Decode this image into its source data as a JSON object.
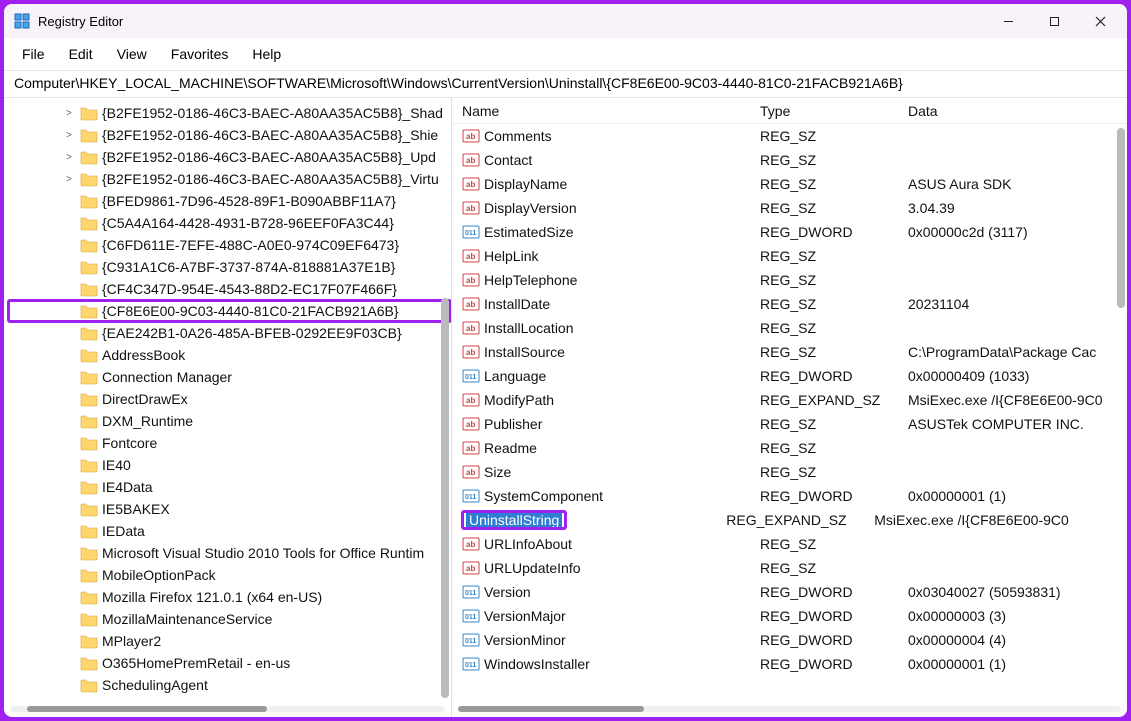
{
  "app": {
    "title": "Registry Editor"
  },
  "menubar": [
    "File",
    "Edit",
    "View",
    "Favorites",
    "Help"
  ],
  "address": "Computer\\HKEY_LOCAL_MACHINE\\SOFTWARE\\Microsoft\\Windows\\CurrentVersion\\Uninstall\\{CF8E6E00-9C03-4440-81C0-21FACB921A6B}",
  "tree": [
    {
      "label": "{B2FE1952-0186-46C3-BAEC-A80AA35AC5B8}_Shad",
      "caret": ">"
    },
    {
      "label": "{B2FE1952-0186-46C3-BAEC-A80AA35AC5B8}_Shie",
      "caret": ">"
    },
    {
      "label": "{B2FE1952-0186-46C3-BAEC-A80AA35AC5B8}_Upd",
      "caret": ">"
    },
    {
      "label": "{B2FE1952-0186-46C3-BAEC-A80AA35AC5B8}_Virtu",
      "caret": ">"
    },
    {
      "label": "{BFED9861-7D96-4528-89F1-B090ABBF11A7}",
      "caret": ""
    },
    {
      "label": "{C5A4A164-4428-4931-B728-96EEF0FA3C44}",
      "caret": ""
    },
    {
      "label": "{C6FD611E-7EFE-488C-A0E0-974C09EF6473}",
      "caret": ""
    },
    {
      "label": "{C931A1C6-A7BF-3737-874A-818881A37E1B}",
      "caret": ""
    },
    {
      "label": "{CF4C347D-954E-4543-88D2-EC17F07F466F}",
      "caret": ""
    },
    {
      "label": "{CF8E6E00-9C03-4440-81C0-21FACB921A6B}",
      "caret": "",
      "highlighted": true
    },
    {
      "label": "{EAE242B1-0A26-485A-BFEB-0292EE9F03CB}",
      "caret": ""
    },
    {
      "label": "AddressBook",
      "caret": ""
    },
    {
      "label": "Connection Manager",
      "caret": ""
    },
    {
      "label": "DirectDrawEx",
      "caret": ""
    },
    {
      "label": "DXM_Runtime",
      "caret": ""
    },
    {
      "label": "Fontcore",
      "caret": ""
    },
    {
      "label": "IE40",
      "caret": ""
    },
    {
      "label": "IE4Data",
      "caret": ""
    },
    {
      "label": "IE5BAKEX",
      "caret": ""
    },
    {
      "label": "IEData",
      "caret": ""
    },
    {
      "label": "Microsoft Visual Studio 2010 Tools for Office Runtim",
      "caret": ""
    },
    {
      "label": "MobileOptionPack",
      "caret": ""
    },
    {
      "label": "Mozilla Firefox 121.0.1 (x64 en-US)",
      "caret": ""
    },
    {
      "label": "MozillaMaintenanceService",
      "caret": ""
    },
    {
      "label": "MPlayer2",
      "caret": ""
    },
    {
      "label": "O365HomePremRetail - en-us",
      "caret": ""
    },
    {
      "label": "SchedulingAgent",
      "caret": ""
    }
  ],
  "columns": {
    "name": "Name",
    "type": "Type",
    "data": "Data"
  },
  "values": [
    {
      "icon": "sz",
      "name": "Comments",
      "type": "REG_SZ",
      "data": ""
    },
    {
      "icon": "sz",
      "name": "Contact",
      "type": "REG_SZ",
      "data": ""
    },
    {
      "icon": "sz",
      "name": "DisplayName",
      "type": "REG_SZ",
      "data": "ASUS Aura SDK"
    },
    {
      "icon": "sz",
      "name": "DisplayVersion",
      "type": "REG_SZ",
      "data": "3.04.39"
    },
    {
      "icon": "dw",
      "name": "EstimatedSize",
      "type": "REG_DWORD",
      "data": "0x00000c2d (3117)"
    },
    {
      "icon": "sz",
      "name": "HelpLink",
      "type": "REG_SZ",
      "data": ""
    },
    {
      "icon": "sz",
      "name": "HelpTelephone",
      "type": "REG_SZ",
      "data": ""
    },
    {
      "icon": "sz",
      "name": "InstallDate",
      "type": "REG_SZ",
      "data": "20231104"
    },
    {
      "icon": "sz",
      "name": "InstallLocation",
      "type": "REG_SZ",
      "data": ""
    },
    {
      "icon": "sz",
      "name": "InstallSource",
      "type": "REG_SZ",
      "data": "C:\\ProgramData\\Package Cac"
    },
    {
      "icon": "dw",
      "name": "Language",
      "type": "REG_DWORD",
      "data": "0x00000409 (1033)"
    },
    {
      "icon": "sz",
      "name": "ModifyPath",
      "type": "REG_EXPAND_SZ",
      "data": "MsiExec.exe /I{CF8E6E00-9C0"
    },
    {
      "icon": "sz",
      "name": "Publisher",
      "type": "REG_SZ",
      "data": "ASUSTek COMPUTER INC."
    },
    {
      "icon": "sz",
      "name": "Readme",
      "type": "REG_SZ",
      "data": ""
    },
    {
      "icon": "sz",
      "name": "Size",
      "type": "REG_SZ",
      "data": ""
    },
    {
      "icon": "dw",
      "name": "SystemComponent",
      "type": "REG_DWORD",
      "data": "0x00000001 (1)"
    },
    {
      "icon": "sz",
      "name": "UninstallString",
      "type": "REG_EXPAND_SZ",
      "data": "MsiExec.exe /I{CF8E6E00-9C0",
      "selected": true
    },
    {
      "icon": "sz",
      "name": "URLInfoAbout",
      "type": "REG_SZ",
      "data": ""
    },
    {
      "icon": "sz",
      "name": "URLUpdateInfo",
      "type": "REG_SZ",
      "data": ""
    },
    {
      "icon": "dw",
      "name": "Version",
      "type": "REG_DWORD",
      "data": "0x03040027 (50593831)"
    },
    {
      "icon": "dw",
      "name": "VersionMajor",
      "type": "REG_DWORD",
      "data": "0x00000003 (3)"
    },
    {
      "icon": "dw",
      "name": "VersionMinor",
      "type": "REG_DWORD",
      "data": "0x00000004 (4)"
    },
    {
      "icon": "dw",
      "name": "WindowsInstaller",
      "type": "REG_DWORD",
      "data": "0x00000001 (1)"
    }
  ]
}
